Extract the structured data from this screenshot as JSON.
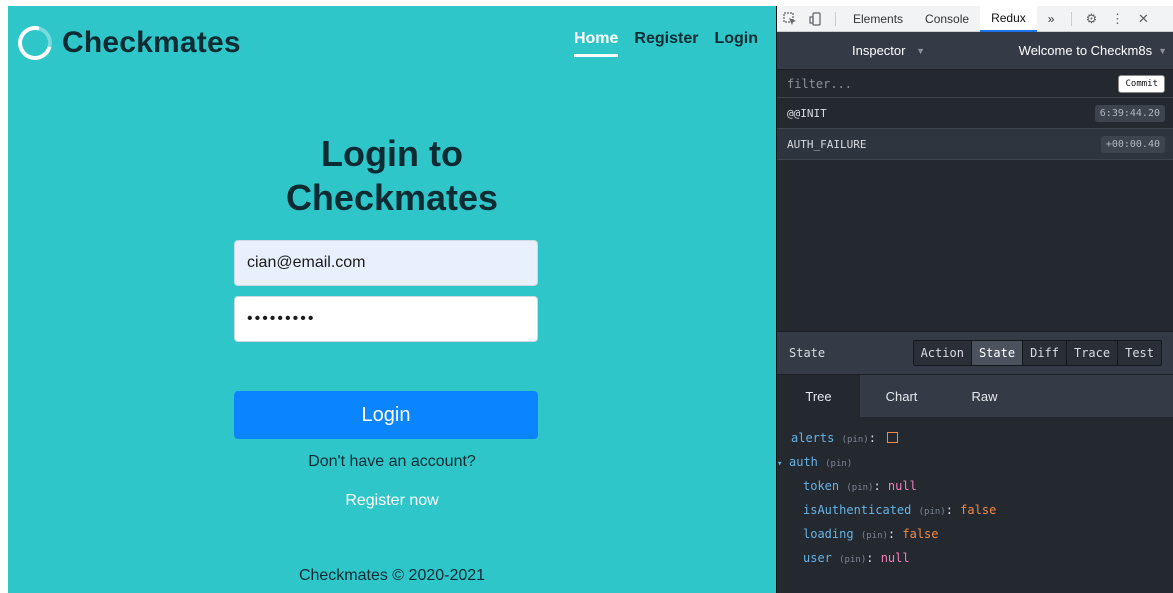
{
  "app": {
    "brand": "Checkmates",
    "nav": {
      "home": "Home",
      "register": "Register",
      "login": "Login"
    },
    "title_line1": "Login to",
    "title_line2": "Checkmates",
    "email_value": "cian@email.com",
    "password_value": "•••••••••",
    "login_button": "Login",
    "no_account": "Don't have an account?",
    "register_now": "Register now",
    "footer": "Checkmates © 2020-2021",
    "colors": {
      "background": "#2ec6c9",
      "primary": "#0a84ff",
      "text": "#0d2b33"
    }
  },
  "devtools": {
    "tabs": {
      "elements": "Elements",
      "console": "Console",
      "redux": "Redux",
      "more": "»"
    },
    "icons": {
      "inspect": "inspect-element-icon",
      "device": "device-toggle-icon",
      "settings": "gear-icon",
      "menu": "kebab-menu-icon",
      "close": "close-icon"
    },
    "monitor": "Inspector",
    "instance": "Welcome to Checkm8s",
    "filter_placeholder": "filter...",
    "commit": "Commit",
    "actions": [
      {
        "name": "@@INIT",
        "time": "6:39:44.20"
      },
      {
        "name": "AUTH_FAILURE",
        "time": "+00:00.40"
      }
    ],
    "state_label": "State",
    "segments": [
      "Action",
      "State",
      "Diff",
      "Trace",
      "Test"
    ],
    "active_segment": "State",
    "view_tabs": [
      "Tree",
      "Chart",
      "Raw"
    ],
    "tree": {
      "pin": "(pin)",
      "alerts_key": "alerts",
      "auth_key": "auth",
      "token_key": "token",
      "token_val": "null",
      "isAuth_key": "isAuthenticated",
      "isAuth_val": "false",
      "loading_key": "loading",
      "loading_val": "false",
      "user_key": "user",
      "user_val": "null"
    }
  }
}
